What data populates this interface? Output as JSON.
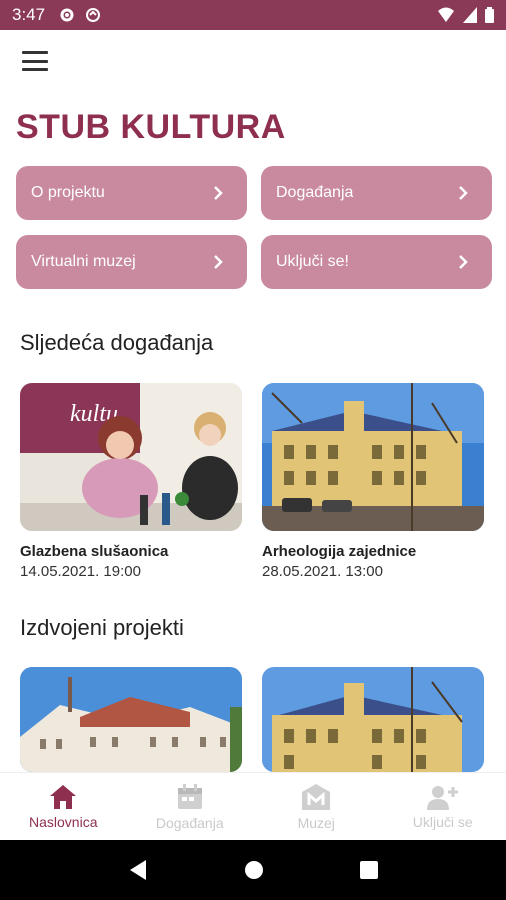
{
  "status_bar": {
    "time": "3:47"
  },
  "app": {
    "title": "STUB KULTURA"
  },
  "nav_buttons": [
    {
      "label": "O projektu"
    },
    {
      "label": "Događanja"
    },
    {
      "label": "Virtualni muzej"
    },
    {
      "label": "Uključi se!"
    }
  ],
  "sections": {
    "events_title": "Sljedeća događanja",
    "projects_title": "Izdvojeni projekti"
  },
  "events": [
    {
      "name": "Glazbena slušaonica",
      "date": "14.05.2021. 19:00"
    },
    {
      "name": "Arheologija zajednice",
      "date": "28.05.2021. 13:00"
    }
  ],
  "bottom_nav": [
    {
      "label": "Naslovnica",
      "icon": "home-icon",
      "active": true
    },
    {
      "label": "Događanja",
      "icon": "calendar-icon",
      "active": false
    },
    {
      "label": "Muzej",
      "icon": "museum-icon",
      "active": false
    },
    {
      "label": "Uključi se",
      "icon": "add-person-icon",
      "active": false
    }
  ],
  "colors": {
    "primary": "#8e2f4f",
    "button": "#c98a9f",
    "status_bar": "#8a3a57"
  }
}
